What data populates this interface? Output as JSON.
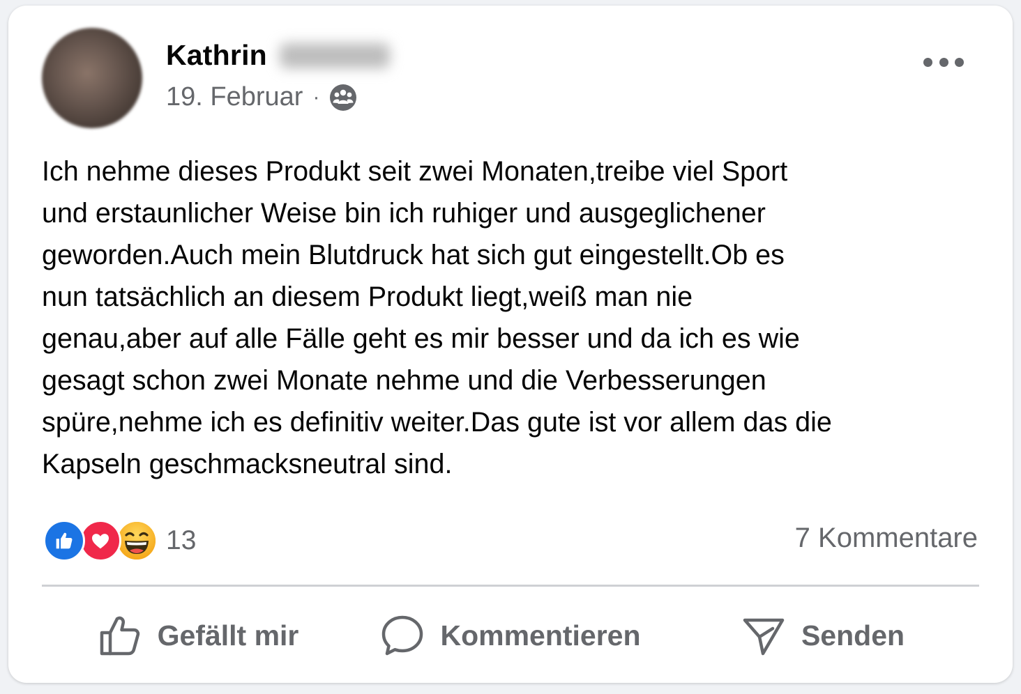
{
  "post": {
    "author_first_name": "Kathrin",
    "date": "19. Februar",
    "separator": "·",
    "audience_icon": "friends-icon",
    "text_lines": [
      "Ich nehme dieses Produkt seit zwei Monaten,treibe viel Sport",
      "und erstaunlicher Weise bin ich ruhiger und ausgeglichener",
      "geworden.Auch mein Blutdruck hat sich gut eingestellt.Ob es",
      "nun tatsächlich an diesem Produkt liegt,weiß man nie",
      "genau,aber auf alle Fälle geht es mir besser und da ich es wie",
      "gesagt schon zwei Monate nehme und die Verbesserungen",
      "spüre,nehme ich es definitiv weiter.Das gute ist vor allem das die",
      "Kapseln geschmacksneutral sind."
    ]
  },
  "reactions": {
    "types": [
      "like-icon",
      "love-icon",
      "haha-icon"
    ],
    "count": "13"
  },
  "comments": {
    "label": "7 Kommentare"
  },
  "actions": {
    "like_label": "Gefällt mir",
    "comment_label": "Kommentieren",
    "send_label": "Senden"
  },
  "colors": {
    "like": "#1b74e4",
    "love": "#f0284a",
    "haha": "#f7b125",
    "secondary_text": "#65676b",
    "primary_text": "#050505"
  }
}
